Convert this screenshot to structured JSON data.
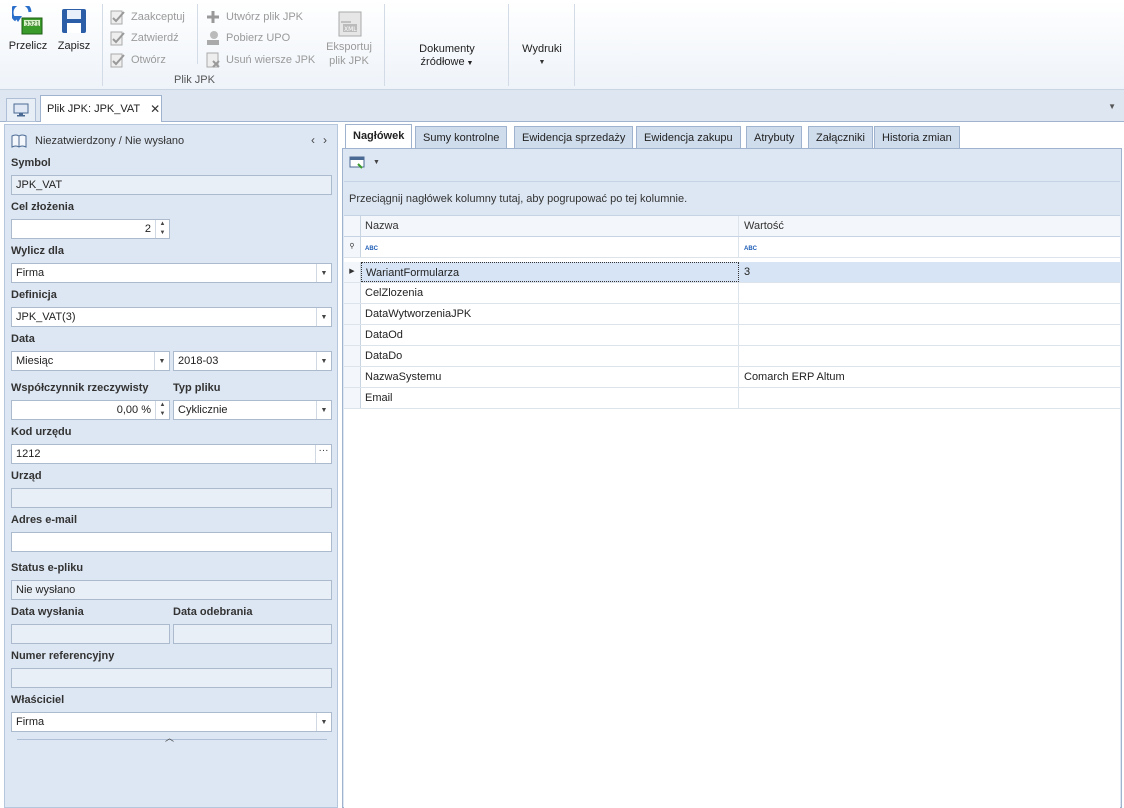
{
  "ribbon": {
    "przelicz": "Przelicz",
    "zapisz": "Zapisz",
    "zaakceptuj": "Zaakceptuj",
    "zatwierdz": "Zatwierdź",
    "otworz": "Otwórz",
    "utworz": "Utwórz plik JPK",
    "pobierz": "Pobierz UPO",
    "usun": "Usuń wiersze JPK",
    "eksportuj_line1": "Eksportuj",
    "eksportuj_line2": "plik JPK",
    "group_label": "Plik JPK",
    "dokumenty_line1": "Dokumenty",
    "dokumenty_line2": "źródłowe",
    "wydruki": "Wydruki"
  },
  "tab": {
    "title": "Plik JPK: JPK_VAT",
    "close": "✕"
  },
  "left": {
    "status": "Niezatwierdzony / Nie wysłano",
    "symbol_label": "Symbol",
    "symbol": "JPK_VAT",
    "cel_label": "Cel złożenia",
    "cel": "2",
    "wylicz_label": "Wylicz dla",
    "wylicz": "Firma",
    "definicja_label": "Definicja",
    "definicja": "JPK_VAT(3)",
    "data_label": "Data",
    "data_typ": "Miesiąc",
    "data_okres": "2018-03",
    "wspolczynnik_label": "Współczynnik rzeczywisty",
    "wspolczynnik": "0,00 %",
    "typ_label": "Typ pliku",
    "typ": "Cyklicznie",
    "kod_label": "Kod urzędu",
    "kod": "1212",
    "urzad_label": "Urząd",
    "urzad": "",
    "email_label": "Adres e-mail",
    "email": "",
    "status_label": "Status e-pliku",
    "status_epliku": "Nie wysłano",
    "data_wyslania_label": "Data wysłania",
    "data_odebrania_label": "Data odebrania",
    "numer_label": "Numer referencyjny",
    "wlasciciel_label": "Właściciel",
    "wlasciciel": "Firma"
  },
  "tabs": [
    "Nagłówek",
    "Sumy kontrolne",
    "Ewidencja sprzedaży",
    "Ewidencja zakupu",
    "Atrybuty",
    "Załączniki",
    "Historia zmian"
  ],
  "grid": {
    "group_hint": "Przeciągnij nagłówek kolumny tutaj, aby pogrupować po tej kolumnie.",
    "col_nazwa": "Nazwa",
    "col_wartosc": "Wartość",
    "filter_abc": "ABC",
    "rows": [
      {
        "nazwa": "WariantFormularza",
        "wartosc": "3"
      },
      {
        "nazwa": "CelZlozenia",
        "wartosc": ""
      },
      {
        "nazwa": "DataWytworzeniaJPK",
        "wartosc": ""
      },
      {
        "nazwa": "DataOd",
        "wartosc": ""
      },
      {
        "nazwa": "DataDo",
        "wartosc": ""
      },
      {
        "nazwa": "NazwaSystemu",
        "wartosc": "Comarch ERP Altum"
      },
      {
        "nazwa": "Email",
        "wartosc": ""
      }
    ]
  },
  "colors": {
    "accent": "#1b5bb5",
    "panel": "#dde7f3",
    "selected_row": "#d6e4f5"
  }
}
